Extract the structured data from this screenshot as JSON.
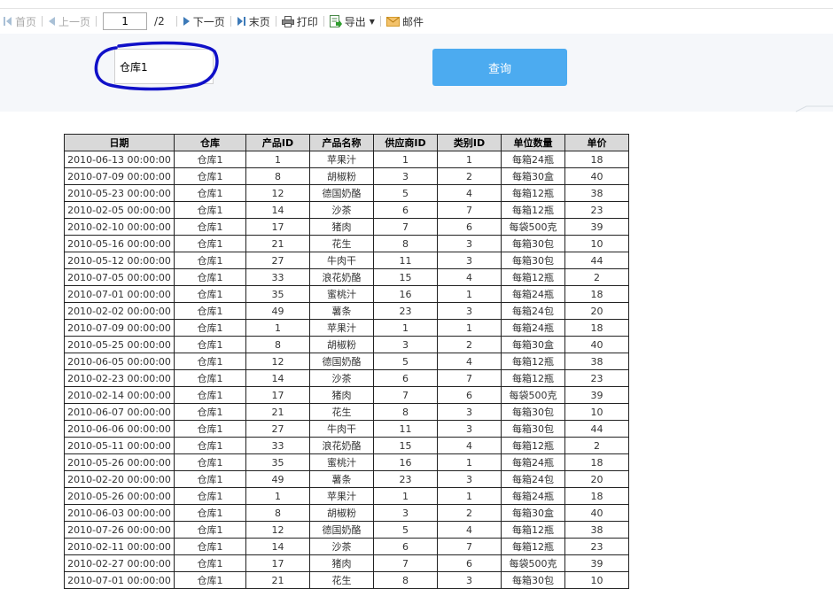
{
  "toolbar": {
    "first": "首页",
    "prev": "上一页",
    "page_value": "1",
    "page_total": "/2",
    "next": "下一页",
    "last": "末页",
    "print": "打印",
    "export": "导出",
    "mail": "邮件"
  },
  "params": {
    "warehouse_value": "仓库1",
    "query_label": "查询",
    "annotation_color": "#1010c8"
  },
  "table": {
    "headers": [
      "日期",
      "仓库",
      "产品ID",
      "产品名称",
      "供应商ID",
      "类别ID",
      "单位数量",
      "单价"
    ],
    "rows": [
      [
        "2010-06-13 00:00:00",
        "仓库1",
        "1",
        "苹果汁",
        "1",
        "1",
        "每箱24瓶",
        "18"
      ],
      [
        "2010-07-09 00:00:00",
        "仓库1",
        "8",
        "胡椒粉",
        "3",
        "2",
        "每箱30盒",
        "40"
      ],
      [
        "2010-05-23 00:00:00",
        "仓库1",
        "12",
        "德国奶酪",
        "5",
        "4",
        "每箱12瓶",
        "38"
      ],
      [
        "2010-02-05 00:00:00",
        "仓库1",
        "14",
        "沙茶",
        "6",
        "7",
        "每箱12瓶",
        "23"
      ],
      [
        "2010-02-10 00:00:00",
        "仓库1",
        "17",
        "猪肉",
        "7",
        "6",
        "每袋500克",
        "39"
      ],
      [
        "2010-05-16 00:00:00",
        "仓库1",
        "21",
        "花生",
        "8",
        "3",
        "每箱30包",
        "10"
      ],
      [
        "2010-05-12 00:00:00",
        "仓库1",
        "27",
        "牛肉干",
        "11",
        "3",
        "每箱30包",
        "44"
      ],
      [
        "2010-07-05 00:00:00",
        "仓库1",
        "33",
        "浪花奶酪",
        "15",
        "4",
        "每箱12瓶",
        "2"
      ],
      [
        "2010-07-01 00:00:00",
        "仓库1",
        "35",
        "蜜桃汁",
        "16",
        "1",
        "每箱24瓶",
        "18"
      ],
      [
        "2010-02-02 00:00:00",
        "仓库1",
        "49",
        "薯条",
        "23",
        "3",
        "每箱24包",
        "20"
      ],
      [
        "2010-07-09 00:00:00",
        "仓库1",
        "1",
        "苹果汁",
        "1",
        "1",
        "每箱24瓶",
        "18"
      ],
      [
        "2010-05-25 00:00:00",
        "仓库1",
        "8",
        "胡椒粉",
        "3",
        "2",
        "每箱30盒",
        "40"
      ],
      [
        "2010-06-05 00:00:00",
        "仓库1",
        "12",
        "德国奶酪",
        "5",
        "4",
        "每箱12瓶",
        "38"
      ],
      [
        "2010-02-23 00:00:00",
        "仓库1",
        "14",
        "沙茶",
        "6",
        "7",
        "每箱12瓶",
        "23"
      ],
      [
        "2010-02-14 00:00:00",
        "仓库1",
        "17",
        "猪肉",
        "7",
        "6",
        "每袋500克",
        "39"
      ],
      [
        "2010-06-07 00:00:00",
        "仓库1",
        "21",
        "花生",
        "8",
        "3",
        "每箱30包",
        "10"
      ],
      [
        "2010-06-06 00:00:00",
        "仓库1",
        "27",
        "牛肉干",
        "11",
        "3",
        "每箱30包",
        "44"
      ],
      [
        "2010-05-11 00:00:00",
        "仓库1",
        "33",
        "浪花奶酪",
        "15",
        "4",
        "每箱12瓶",
        "2"
      ],
      [
        "2010-05-26 00:00:00",
        "仓库1",
        "35",
        "蜜桃汁",
        "16",
        "1",
        "每箱24瓶",
        "18"
      ],
      [
        "2010-02-20 00:00:00",
        "仓库1",
        "49",
        "薯条",
        "23",
        "3",
        "每箱24包",
        "20"
      ],
      [
        "2010-05-26 00:00:00",
        "仓库1",
        "1",
        "苹果汁",
        "1",
        "1",
        "每箱24瓶",
        "18"
      ],
      [
        "2010-06-03 00:00:00",
        "仓库1",
        "8",
        "胡椒粉",
        "3",
        "2",
        "每箱30盒",
        "40"
      ],
      [
        "2010-07-26 00:00:00",
        "仓库1",
        "12",
        "德国奶酪",
        "5",
        "4",
        "每箱12瓶",
        "38"
      ],
      [
        "2010-02-11 00:00:00",
        "仓库1",
        "14",
        "沙茶",
        "6",
        "7",
        "每箱12瓶",
        "23"
      ],
      [
        "2010-02-27 00:00:00",
        "仓库1",
        "17",
        "猪肉",
        "7",
        "6",
        "每袋500克",
        "39"
      ],
      [
        "2010-07-01 00:00:00",
        "仓库1",
        "21",
        "花生",
        "8",
        "3",
        "每箱30包",
        "10"
      ]
    ]
  }
}
